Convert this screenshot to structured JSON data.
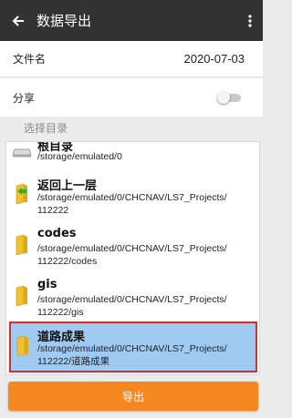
{
  "appbar": {
    "title": "数据导出",
    "back_icon": "arrow-left-icon",
    "more_icon": "more-vert-icon"
  },
  "file_row": {
    "label": "文件名",
    "value": "2020-07-03"
  },
  "share_row": {
    "label": "分享",
    "toggle_on": false
  },
  "section_header": "选择目录",
  "directory_items": [
    {
      "name": "根目录",
      "path": "/storage/emulated/0",
      "icon": "drive-icon"
    },
    {
      "name": "返回上一层",
      "path": "/storage/emulated/0/CHCNAV/LS7_Projects/\n112222",
      "icon": "folder-up-icon"
    },
    {
      "name": "codes",
      "path": "/storage/emulated/0/CHCNAV/LS7_Projects/\n112222/codes",
      "icon": "folder-icon"
    },
    {
      "name": "gis",
      "path": "/storage/emulated/0/CHCNAV/LS7_Projects/\n112222/gis",
      "icon": "folder-icon"
    },
    {
      "name": "道路成果",
      "path": "/storage/emulated/0/CHCNAV/LS7_Projects/\n112222/道路成果",
      "icon": "folder-icon",
      "selected": true
    }
  ],
  "export_button": "导出",
  "colors": {
    "appbar": "#323232",
    "accent": "#f5881f",
    "selected_bg": "#9fcaf2",
    "selected_border": "#e12a2a",
    "folder": "#f2c12e"
  }
}
